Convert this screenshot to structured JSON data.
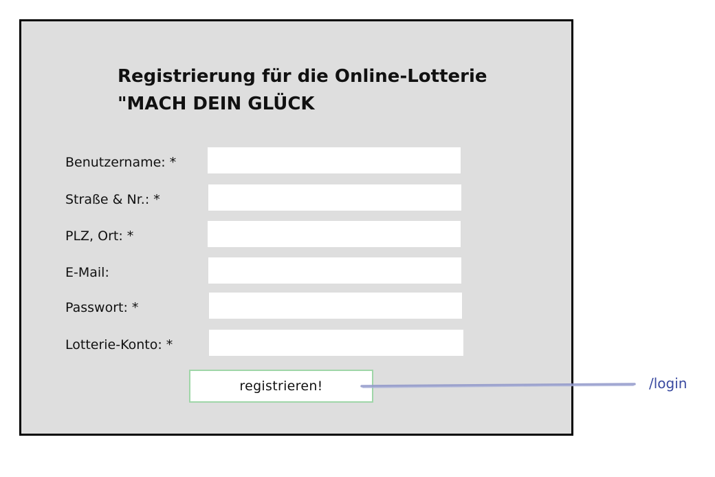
{
  "form": {
    "title_line1": "Registrierung für die Online-Lotterie",
    "title_line2": "\"MACH DEIN GLÜCK",
    "fields": [
      {
        "label": "Benutzername: *",
        "value": ""
      },
      {
        "label": "Straße & Nr.: *",
        "value": ""
      },
      {
        "label": "PLZ, Ort: *",
        "value": ""
      },
      {
        "label": "E-Mail:",
        "value": ""
      },
      {
        "label": "Passwort: *",
        "value": ""
      },
      {
        "label": "Lotterie-Konto: *",
        "value": ""
      }
    ],
    "submit_label": "registrieren!"
  },
  "annotation": {
    "route": "/login",
    "colors": {
      "connector": "#8f97c9",
      "route_text": "#3a4aa0",
      "button_border": "#9fd6a8",
      "panel_bg": "#dedede"
    }
  }
}
